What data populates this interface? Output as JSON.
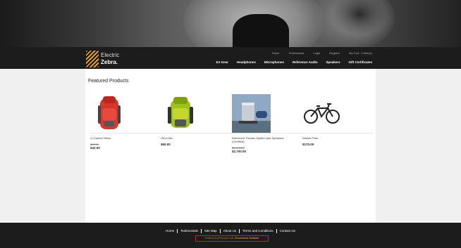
{
  "header": {
    "logo_line1": "Electric",
    "logo_line2": "Zebra.",
    "top_links": [
      "Home",
      "Testimonials",
      "Login",
      "Register",
      "My Cart : 0 item(s)"
    ],
    "main_nav": [
      "DJ Gear",
      "Headphones",
      "Microphones",
      "Reference Audio",
      "Speakers",
      "Gift Certificates"
    ]
  },
  "main": {
    "heading": "Featured Products",
    "products": [
      {
        "name": "4-Channel Mixer",
        "old_price": "$49.00",
        "price": "$42.00"
      },
      {
        "name": "Omni Mic",
        "old_price": "",
        "price": "$50.00"
      },
      {
        "name": "Reference Theater System and Speakers (Certified)",
        "old_price": "$3,999.00",
        "price": "$2,700.00"
      },
      {
        "name": "Warder Pain",
        "old_price": "",
        "price": "$170.00"
      }
    ]
  },
  "footer": {
    "links": [
      "Home",
      "Testimonials",
      "Site Map",
      "About Us",
      "Terms and Conditions",
      "Contact Us"
    ],
    "powered_prefix": "Powered by Pinnacle Cart",
    "powered_link": "Ecommerce Software"
  },
  "colors": {
    "accent": "#e0a21c",
    "nav_bg": "#1c1c1c",
    "highlight_border": "#d42020"
  }
}
